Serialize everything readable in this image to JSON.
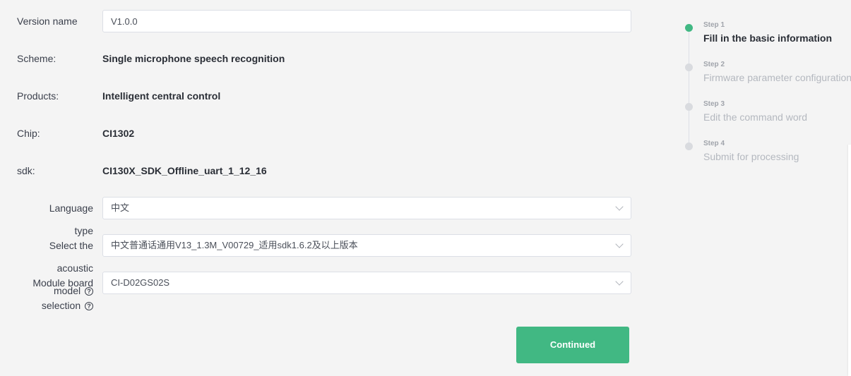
{
  "form": {
    "version_label": "Version name",
    "version_value": "V1.0.0",
    "scheme_label": "Scheme:",
    "scheme_value": "Single microphone speech recognition",
    "products_label": "Products:",
    "products_value": "Intelligent central control",
    "chip_label": "Chip:",
    "chip_value": "CI1302",
    "sdk_label": "sdk:",
    "sdk_value": "CI130X_SDK_Offline_uart_1_12_16",
    "language_label_1": "Language",
    "language_label_2": "type",
    "language_value": "中文",
    "acoustic_label_1": "Select the",
    "acoustic_label_2": "acoustic",
    "acoustic_label_3": "model",
    "acoustic_value": "中文普通话通用V13_1.3M_V00729_适用sdk1.6.2及以上版本",
    "module_label_1": "Module board",
    "module_label_2": "selection",
    "module_value": "CI-D02GS02S",
    "help_glyph": "?",
    "continue_label": "Continued"
  },
  "steps": [
    {
      "num": "Step 1",
      "title": "Fill in the basic information",
      "active": true
    },
    {
      "num": "Step 2",
      "title": "Firmware parameter configuration",
      "active": false
    },
    {
      "num": "Step 3",
      "title": "Edit the command word",
      "active": false
    },
    {
      "num": "Step 4",
      "title": "Submit for processing",
      "active": false
    }
  ],
  "colors": {
    "accent": "#41b883",
    "background": "#f4f4f4"
  }
}
